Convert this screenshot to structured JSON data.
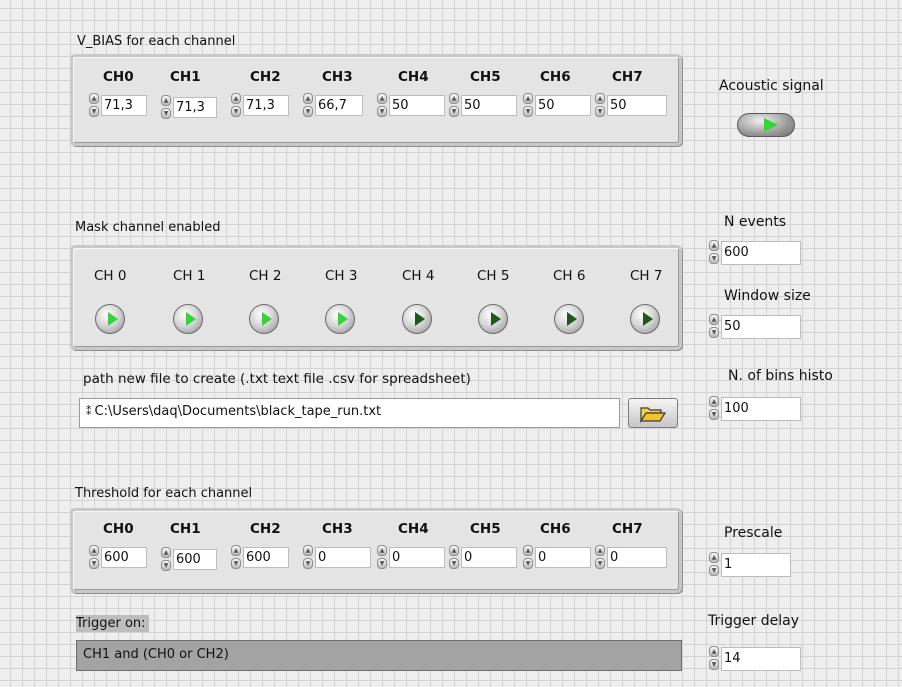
{
  "vbias": {
    "title": "V_BIAS for each channel",
    "channels": [
      "CH0",
      "CH1",
      "CH2",
      "CH3",
      "CH4",
      "CH5",
      "CH6",
      "CH7"
    ],
    "values": [
      "71,3",
      "71,3",
      "71,3",
      "66,7",
      "50",
      "50",
      "50",
      "50"
    ]
  },
  "acoustic": {
    "label": "Acoustic signal",
    "state": "on"
  },
  "mask": {
    "title": "Mask channel enabled",
    "channels": [
      "CH 0",
      "CH 1",
      "CH 2",
      "CH 3",
      "CH 4",
      "CH 5",
      "CH 6",
      "CH 7"
    ],
    "states": [
      "on",
      "on",
      "on",
      "on",
      "off",
      "off",
      "off",
      "off"
    ]
  },
  "n_events": {
    "label": "N events",
    "value": "600"
  },
  "window_size": {
    "label": "Window size",
    "value": "50"
  },
  "path": {
    "label": "path new file to create  (.txt text file  .csv for spreadsheet)",
    "value": "C:\\Users\\daq\\Documents\\black_tape_run.txt",
    "browse_icon": "folder-open-icon"
  },
  "bins": {
    "label": "N. of bins histo",
    "value": "100"
  },
  "threshold": {
    "title": "Threshold for each channel",
    "channels": [
      "CH0",
      "CH1",
      "CH2",
      "CH3",
      "CH4",
      "CH5",
      "CH6",
      "CH7"
    ],
    "values": [
      "600",
      "600",
      "600",
      "0",
      "0",
      "0",
      "0",
      "0"
    ]
  },
  "prescale": {
    "label": "Prescale",
    "value": "1"
  },
  "trigger": {
    "label": "Trigger on:",
    "value": "CH1 and (CH0 or CH2)"
  },
  "trigger_delay": {
    "label": "Trigger delay",
    "value": "14"
  },
  "colors": {
    "led_on": "#33d633",
    "led_off": "#1e5a1e",
    "panel_bg": "#eeeeee",
    "trigger_bg": "#a3a3a3"
  }
}
